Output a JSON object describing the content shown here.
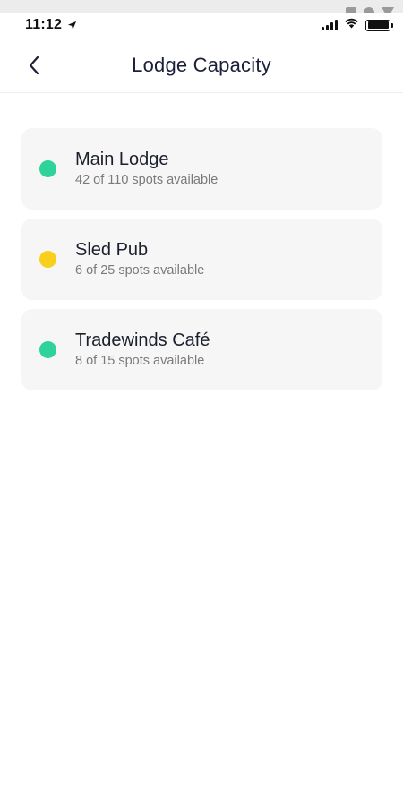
{
  "status_bar": {
    "time": "11:12",
    "location_icon": "location-arrow-icon",
    "signal_icon": "cellular-signal-icon",
    "wifi_icon": "wifi-icon",
    "battery_icon": "battery-icon",
    "overlay_icons": [
      "square-icon",
      "circle-icon",
      "triangle-icon"
    ]
  },
  "header": {
    "back_icon": "chevron-left-icon",
    "title": "Lodge Capacity"
  },
  "colors": {
    "available": "#2ed39a",
    "limited": "#f7cf1c",
    "card_background": "#f6f6f6",
    "title_text": "#1c1f3a",
    "subtitle_text": "#7a7a7a"
  },
  "lodges": [
    {
      "name": "Main Lodge",
      "availability": "42 of 110 spots available",
      "status_color": "#2ed39a"
    },
    {
      "name": "Sled Pub",
      "availability": "6 of 25 spots available",
      "status_color": "#f7cf1c"
    },
    {
      "name": "Tradewinds Café",
      "availability": "8 of 15 spots available",
      "status_color": "#2ed39a"
    }
  ]
}
